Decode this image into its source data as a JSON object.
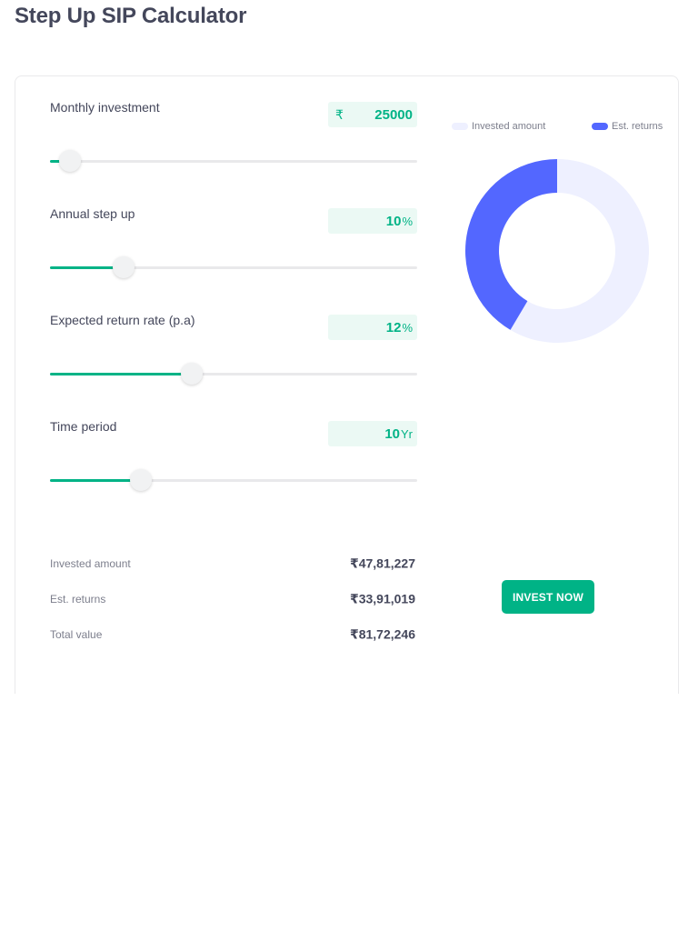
{
  "page": {
    "title": "Step Up SIP Calculator"
  },
  "inputs": [
    {
      "label": "Monthly investment",
      "value": "25000",
      "prefix": "₹",
      "suffix": "",
      "slider_fraction": 0.055
    },
    {
      "label": "Annual step up",
      "value": "10",
      "prefix": "",
      "suffix": "%",
      "slider_fraction": 0.2
    },
    {
      "label": "Expected return rate (p.a)",
      "value": "12",
      "prefix": "",
      "suffix": "%",
      "slider_fraction": 0.387
    },
    {
      "label": "Time period",
      "value": "10",
      "prefix": "",
      "suffix": "Yr",
      "slider_fraction": 0.248
    }
  ],
  "legend": {
    "invested": "Invested amount",
    "returns": "Est. returns"
  },
  "chart_data": {
    "type": "pie",
    "series": [
      {
        "name": "Invested amount",
        "value": 4781227,
        "color": "#eef0ff"
      },
      {
        "name": "Est. returns",
        "value": 3391019,
        "color": "#5367ff"
      }
    ]
  },
  "summary": [
    {
      "label": "Invested amount",
      "value": "₹47,81,227"
    },
    {
      "label": "Est. returns",
      "value": "₹33,91,019"
    },
    {
      "label": "Total value",
      "value": "₹81,72,246"
    }
  ],
  "cta": {
    "label": "INVEST NOW"
  },
  "colors": {
    "accent": "#00b386",
    "returns": "#5367ff",
    "invested": "#eef0ff",
    "value_bg": "#ebf9f4"
  }
}
